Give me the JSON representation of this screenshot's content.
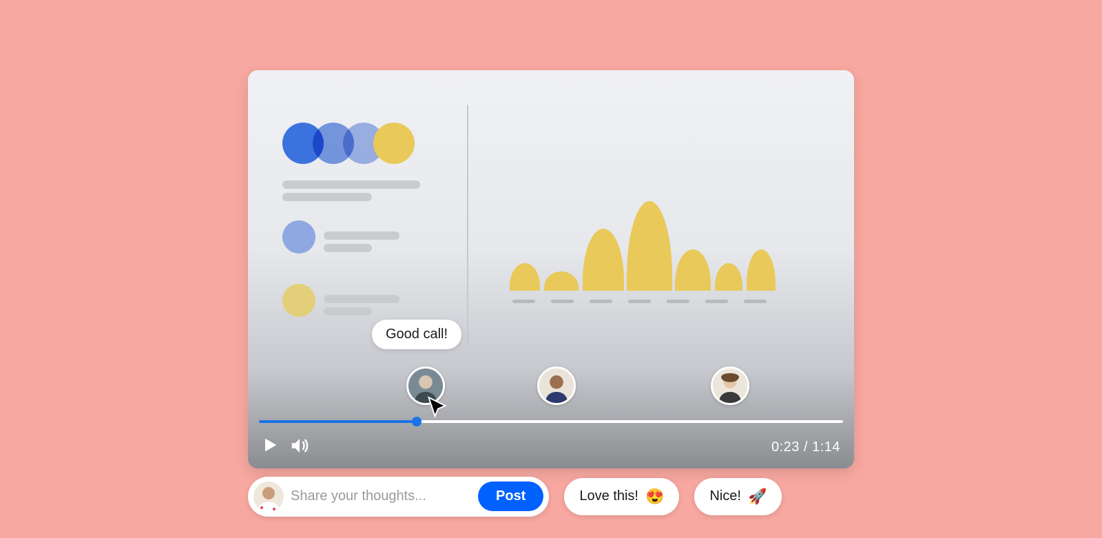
{
  "colors": {
    "accent": "#0061FE",
    "chart": "#E8C95A",
    "background": "#F7A8A0"
  },
  "player": {
    "current_time": "0:23",
    "duration": "1:14",
    "progress_pct": 27
  },
  "tooltip": {
    "text": "Good call!"
  },
  "compose": {
    "placeholder": "Share your thoughts...",
    "post_label": "Post"
  },
  "chips": [
    {
      "text": "Love this!",
      "emoji": "😍"
    },
    {
      "text": "Nice!",
      "emoji": "🚀"
    }
  ],
  "timecode_separator": " / "
}
